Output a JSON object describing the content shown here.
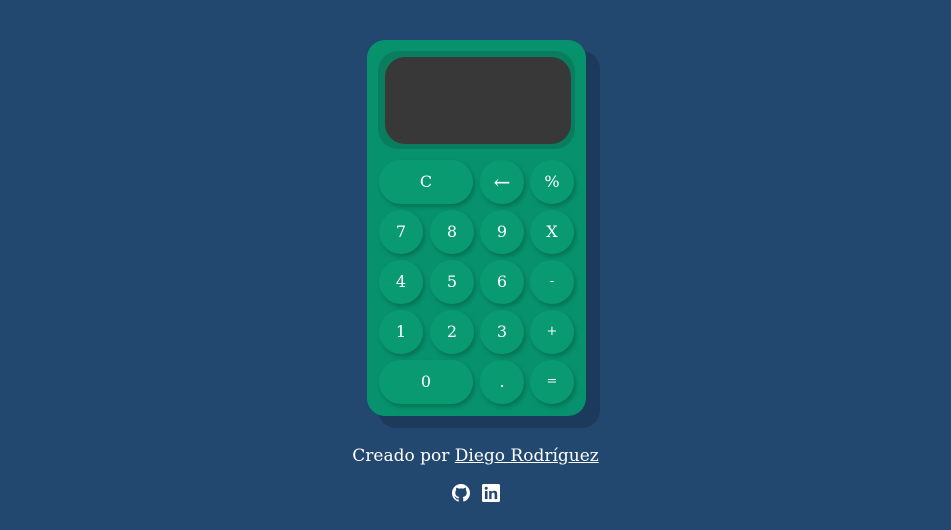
{
  "colors": {
    "background": "#23486f",
    "calculator_body": "#07926d",
    "key": "#0a9a72",
    "screen": "#383838",
    "text": "#ffffff"
  },
  "calculator": {
    "display_value": "",
    "keys": {
      "clear": "C",
      "backspace": "←",
      "percent": "%",
      "seven": "7",
      "eight": "8",
      "nine": "9",
      "multiply": "X",
      "four": "4",
      "five": "5",
      "six": "6",
      "subtract": "-",
      "one": "1",
      "two": "2",
      "three": "3",
      "add": "+",
      "zero": "0",
      "decimal": ".",
      "equals": "="
    }
  },
  "footer": {
    "credit_prefix": "Creado por",
    "author_name": "Diego Rodríguez",
    "icons": [
      "github-icon",
      "linkedin-icon"
    ]
  }
}
